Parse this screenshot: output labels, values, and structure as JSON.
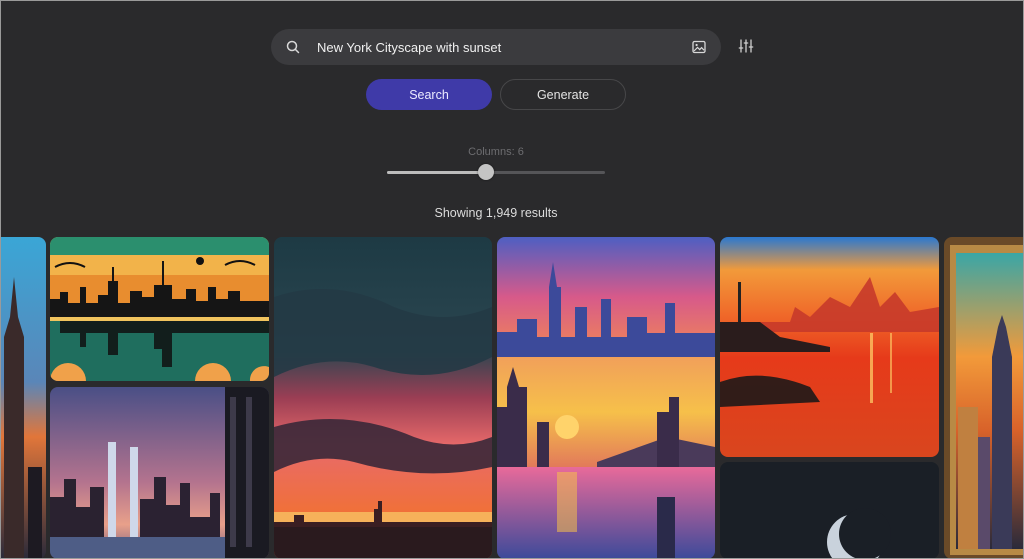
{
  "search": {
    "value": "New York Cityscape with sunset",
    "placeholder": "Search"
  },
  "buttons": {
    "search_label": "Search",
    "generate_label": "Generate"
  },
  "slider": {
    "label": "Columns: 6",
    "value": 6,
    "fraction": 0.45
  },
  "results": {
    "text": "Showing 1,949 results"
  },
  "icons": {
    "search": "search-icon",
    "image_search": "image-icon",
    "filters": "sliders-icon"
  },
  "colors": {
    "background": "#2a2a2c",
    "search_bar": "#3b3b3e",
    "primary_button": "#3f3aa8"
  }
}
